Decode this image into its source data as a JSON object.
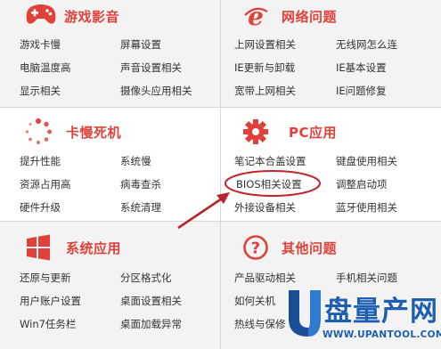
{
  "sections": {
    "games_media": {
      "title": "游戏影音",
      "links": [
        "游戏卡慢",
        "屏幕设置",
        "电脑温度高",
        "声音设置相关",
        "显示相关",
        "摄像头应用相关"
      ]
    },
    "network": {
      "title": "网络问题",
      "links": [
        "上网设置相关",
        "无线网怎么连",
        "IE更新与卸载",
        "IE基本设置",
        "宽带上网相关",
        "IE问题修复"
      ]
    },
    "slow_crash": {
      "title": "卡慢死机",
      "links": [
        "提升性能",
        "系统慢",
        "资源占用高",
        "病毒查杀",
        "硬件升级",
        "系统清理"
      ]
    },
    "pc_apps": {
      "title": "PC应用",
      "links": [
        "笔记本合盖设置",
        "键盘使用相关",
        "BIOS相关设置",
        "调整启动项",
        "外接设备相关",
        "蓝牙使用相关"
      ]
    },
    "system_apps": {
      "title": "系统应用",
      "links": [
        "还原与更新",
        "分区格式化",
        "用户账户设置",
        "桌面设置相关",
        "Win7任务栏",
        "桌面加载异常"
      ]
    },
    "other": {
      "title": "其他问题",
      "links": [
        "产品驱动相关",
        "手机相关问题",
        "如何关机",
        "",
        "热线与保修",
        ""
      ]
    }
  },
  "watermark": {
    "brand": "盘量产网",
    "url": "WWW.UPANTOOL.COM"
  },
  "colors": {
    "accent": "#e0413a",
    "highlight_ring": "#c0272d"
  }
}
